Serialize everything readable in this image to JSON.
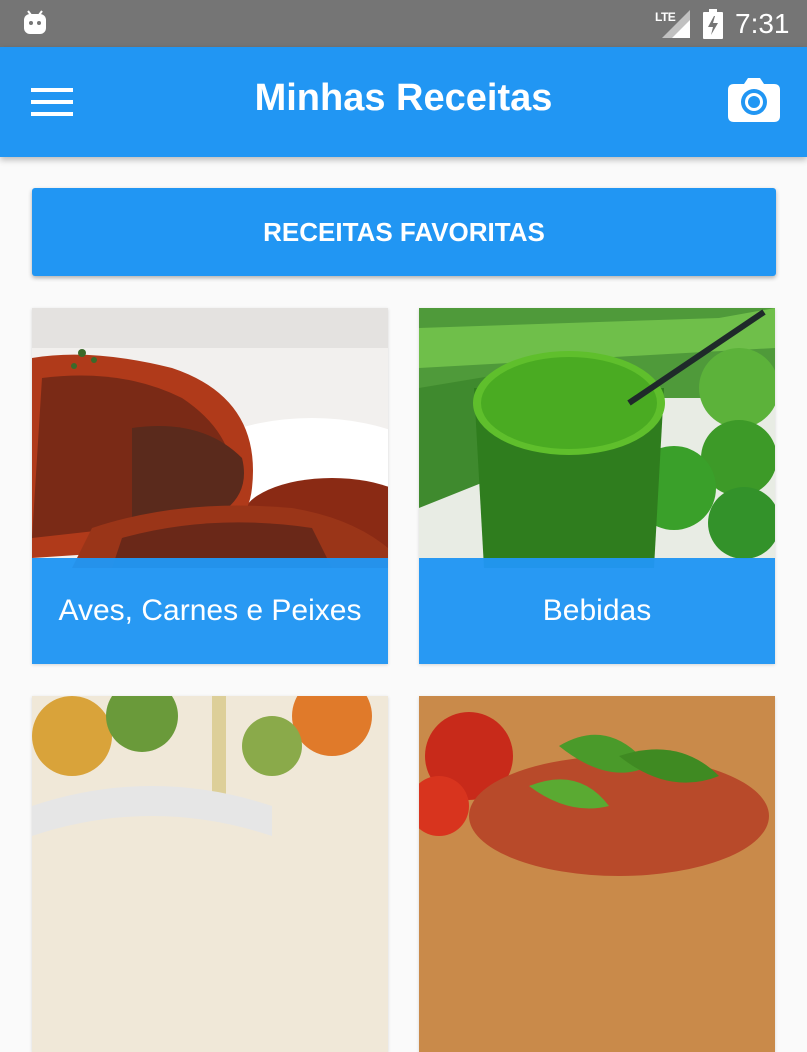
{
  "status_bar": {
    "network": "LTE",
    "time": "7:31",
    "icons": [
      "android-icon",
      "signal-icon",
      "battery-charging-icon"
    ]
  },
  "app_bar": {
    "title": "Minhas Receitas",
    "menu_icon": "menu-icon",
    "camera_icon": "camera-icon"
  },
  "favorites_button": {
    "label": "RECEITAS FAVORITAS"
  },
  "categories": [
    {
      "label": "Aves, Carnes e Peixes",
      "image": "roast-beef"
    },
    {
      "label": "Bebidas",
      "image": "green-juice"
    },
    {
      "label": "",
      "image": "salad-with-oil"
    },
    {
      "label": "",
      "image": "tomatoes-and-basil"
    }
  ],
  "colors": {
    "primary": "#2196f3",
    "status_bar": "#757575",
    "background": "#fafafa",
    "text_on_primary": "#ffffff"
  }
}
